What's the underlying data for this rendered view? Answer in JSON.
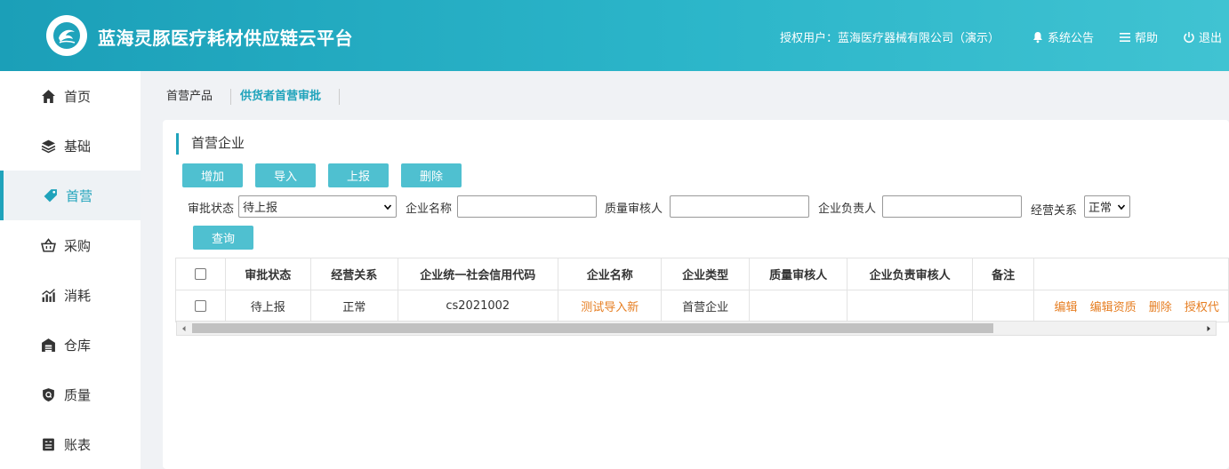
{
  "header": {
    "title": "蓝海灵豚医疗耗材供应链云平台",
    "user_label": "授权用户：蓝海医疗器械有限公司（演示）",
    "notice_label": "系统公告",
    "help_label": "帮助",
    "logout_label": "退出"
  },
  "sidebar": {
    "items": [
      {
        "label": "首页",
        "icon": "home-icon"
      },
      {
        "label": "基础",
        "icon": "layers-icon"
      },
      {
        "label": "首营",
        "icon": "tag-icon",
        "active": true
      },
      {
        "label": "采购",
        "icon": "basket-icon"
      },
      {
        "label": "消耗",
        "icon": "chart-icon"
      },
      {
        "label": "仓库",
        "icon": "warehouse-icon"
      },
      {
        "label": "质量",
        "icon": "shield-icon"
      },
      {
        "label": "账表",
        "icon": "ledger-icon"
      }
    ]
  },
  "breadcrumb": {
    "tabs": [
      {
        "label": "首营产品",
        "active": false
      },
      {
        "label": "供货者首营审批",
        "active": true
      }
    ]
  },
  "panel": {
    "title": "首营企业",
    "buttons": {
      "add": "增加",
      "import": "导入",
      "report": "上报",
      "delete": "删除",
      "query": "查询"
    },
    "filters": {
      "status_label": "审批状态",
      "status_value": "待上报",
      "company_label": "企业名称",
      "company_value": "",
      "qa_label": "质量审核人",
      "qa_value": "",
      "owner_label": "企业负责人",
      "owner_value": "",
      "relation_label": "经营关系",
      "relation_value": "正常"
    }
  },
  "table": {
    "columns": [
      "审批状态",
      "经营关系",
      "企业统一社会信用代码",
      "企业名称",
      "企业类型",
      "质量审核人",
      "企业负责审核人",
      "备注",
      ""
    ],
    "rows": [
      {
        "status": "待上报",
        "relation": "正常",
        "credit_code": "cs2021002",
        "company": "测试导入新",
        "type": "首营企业",
        "qa": "",
        "owner_reviewer": "",
        "remark": "",
        "actions": [
          "编辑",
          "编辑资质",
          "删除",
          "授权代"
        ]
      }
    ]
  },
  "colors": {
    "accent": "#1fa3bb",
    "button": "#4fc0d0",
    "link": "#e67e22"
  }
}
